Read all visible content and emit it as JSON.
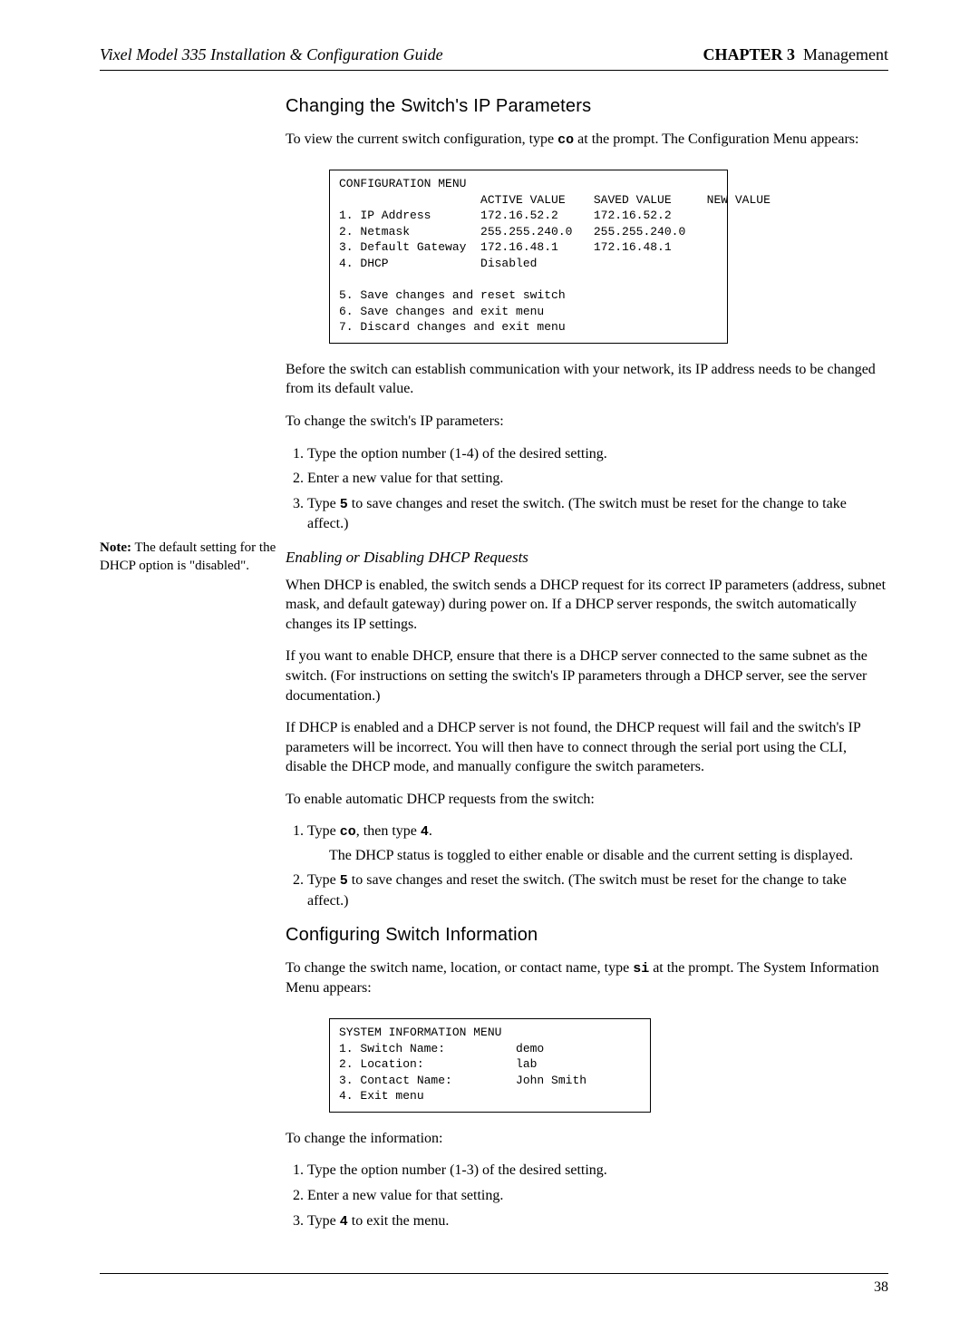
{
  "header": {
    "left": "Vixel Model 335 Installation & Configuration Guide",
    "chapter_label": "CHAPTER 3",
    "chapter_title": "Management"
  },
  "margin_note": {
    "bold": "Note:",
    "text": " The default setting for the DHCP option is \"disabled\"."
  },
  "section1": {
    "title": "Changing the Switch's IP Parameters",
    "intro_before": "To view the current switch configuration, type ",
    "intro_code": "co",
    "intro_after": " at the prompt. The Configuration Menu appears:",
    "config_menu": "CONFIGURATION MENU\n                    ACTIVE VALUE    SAVED VALUE     NEW VALUE\n1. IP Address       172.16.52.2     172.16.52.2\n2. Netmask          255.255.240.0   255.255.240.0\n3. Default Gateway  172.16.48.1     172.16.48.1\n4. DHCP             Disabled\n\n5. Save changes and reset switch\n6. Save changes and exit menu\n7. Discard changes and exit menu",
    "para2": "Before the switch can establish communication with your network, its IP address needs to be changed from its default value.",
    "para3": "To change the switch's IP parameters:",
    "steps1": [
      "Type the option number (1-4) of the desired setting.",
      "Enter a new value for that setting."
    ],
    "step1_3_before": "Type ",
    "step1_3_code": "5",
    "step1_3_after": " to save changes and reset the switch. (The switch must be reset for the change to take affect.)"
  },
  "section2": {
    "subhead": "Enabling or Disabling DHCP Requests",
    "para1": "When DHCP is enabled, the switch sends a DHCP request for its correct IP parameters (address, subnet mask, and default gateway) during power on. If a DHCP server responds, the switch automatically changes its IP settings.",
    "para2": "If you want to enable DHCP, ensure that there is a DHCP server connected to the same subnet as the switch. (For instructions on setting the switch's IP parameters through a DHCP server, see the server documentation.)",
    "para3": "If DHCP is enabled and a DHCP server is not found, the DHCP request will fail and the switch's IP parameters will be incorrect. You will then have to connect through the serial port using the CLI, disable the DHCP mode, and manually configure the switch parameters.",
    "para4": "To enable automatic DHCP requests from the switch:",
    "step1_before": "Type ",
    "step1_code1": "co",
    "step1_mid": ", then type ",
    "step1_code2": "4",
    "step1_after": ".",
    "step1_sub": "The DHCP status is toggled to either enable or disable and the current setting is displayed.",
    "step2_before": "Type ",
    "step2_code": "5",
    "step2_after": " to save changes and reset the switch. (The switch must be reset for the change to take affect.)"
  },
  "section3": {
    "title": "Configuring Switch Information",
    "intro_before": "To change the switch name, location, or contact name, type ",
    "intro_code": "si",
    "intro_after": " at the prompt. The System Information Menu appears:",
    "sys_menu": "SYSTEM INFORMATION MENU\n1. Switch Name:          demo\n2. Location:             lab\n3. Contact Name:         John Smith\n4. Exit menu",
    "para2": "To change the information:",
    "steps": [
      "Type the option number (1-3) of the desired setting.",
      "Enter a new value for that setting."
    ],
    "step3_before": "Type ",
    "step3_code": "4",
    "step3_after": " to exit the menu."
  },
  "footer": {
    "page_number": "38"
  }
}
